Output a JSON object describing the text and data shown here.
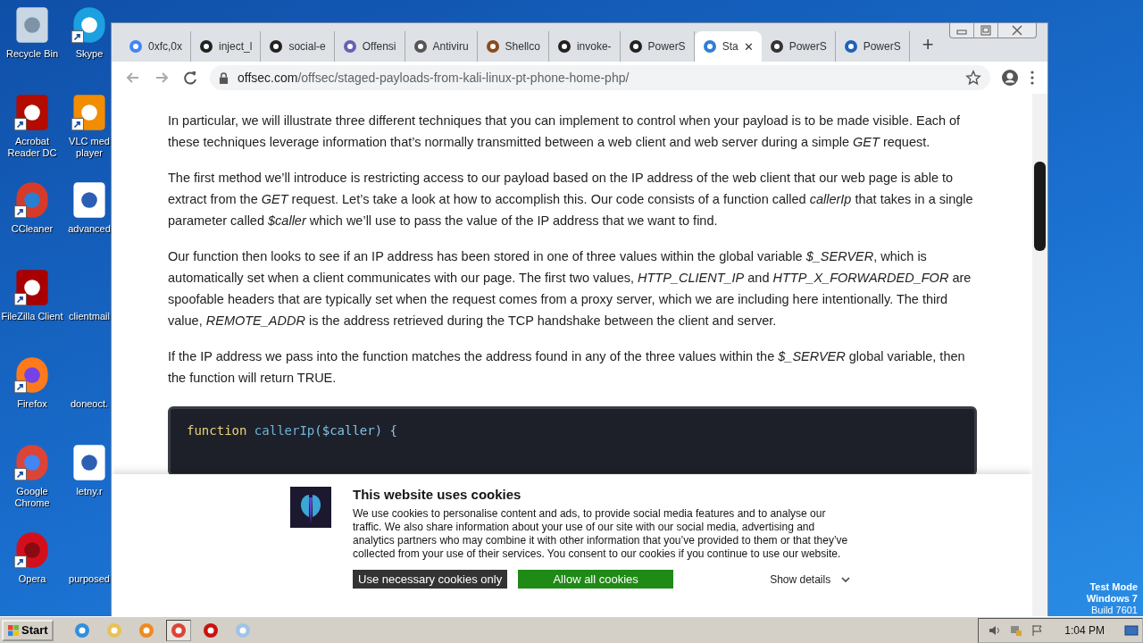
{
  "desktop": {
    "icons": [
      {
        "label": "Recycle Bin",
        "kind": "bin",
        "shortcut": false
      },
      {
        "label": "Skype",
        "kind": "skype",
        "shortcut": true
      },
      {
        "label": "Acrobat Reader DC",
        "kind": "pdf",
        "shortcut": true
      },
      {
        "label": "VLC med player",
        "kind": "cone",
        "shortcut": true
      },
      {
        "label": "CCleaner",
        "kind": "ccleaner",
        "shortcut": true
      },
      {
        "label": "advanced",
        "kind": "doc",
        "shortcut": false
      },
      {
        "label": "FileZilla Client",
        "kind": "filezilla",
        "shortcut": true
      },
      {
        "label": "clientmail",
        "kind": "blank"
      },
      {
        "label": "Firefox",
        "kind": "firefox",
        "shortcut": true
      },
      {
        "label": "doneoct.",
        "kind": "blank"
      },
      {
        "label": "Google Chrome",
        "kind": "chrome",
        "shortcut": true
      },
      {
        "label": "letny.r",
        "kind": "doc",
        "shortcut": false
      },
      {
        "label": "Opera",
        "kind": "opera",
        "shortcut": true
      },
      {
        "label": "purposed",
        "kind": "blank"
      }
    ]
  },
  "browser": {
    "tabs": [
      {
        "label": "0xfc,0x",
        "kind": "google",
        "selected": false
      },
      {
        "label": "inject_l",
        "kind": "github",
        "selected": false
      },
      {
        "label": "social-e",
        "kind": "github",
        "selected": false
      },
      {
        "label": "Offensi",
        "kind": "hex",
        "selected": false
      },
      {
        "label": "Antiviru",
        "kind": "globe",
        "selected": false
      },
      {
        "label": "Shellco",
        "kind": "bug",
        "selected": false
      },
      {
        "label": "invoke-",
        "kind": "github",
        "selected": false
      },
      {
        "label": "PowerS",
        "kind": "github",
        "selected": false
      },
      {
        "label": "Sta",
        "kind": "site",
        "selected": true
      },
      {
        "label": "PowerS",
        "kind": "pt",
        "selected": false
      },
      {
        "label": "PowerS",
        "kind": "ps",
        "selected": false
      }
    ],
    "tab_close": "✕",
    "new_tab": "+",
    "url_domain": "offsec.com",
    "url_path": "/offsec/staged-payloads-from-kali-linux-pt-phone-home-php/"
  },
  "article": {
    "paragraphs": [
      "In particular, we will illustrate three different techniques that you can implement to control when your payload is to be made visible. Each of these techniques leverage information that’s normally transmitted between a web client and web server during a simple *GET* request.",
      "The first method we’ll introduce is restricting access to our payload based on the IP address of the web client that our web page is able to extract from the *GET* request. Let’s take a look at how to accomplish this. Our code consists of a function called *callerIp* that takes in a single parameter called *$caller* which we’ll use to pass the value of the IP address that we want to find.",
      "Our function then looks to see if an IP address has been stored in one of three values within the global variable *$_SERVER*, which is automatically set when a client communicates with our page. The first two values, *HTTP_CLIENT_IP* and *HTTP_X_FORWARDED_FOR* are spoofable headers that are typically set when the request comes from a proxy server, which we are including here intentionally. The third value, *REMOTE_ADDR* is the address retrieved during the TCP handshake between the client and server.",
      "If the IP address we pass into the function matches the address found in any of the three values within the *$_SERVER* global variable, then the function will return TRUE."
    ],
    "code": [
      {
        "text": "function",
        "kind": "keyword"
      },
      {
        "text": " callerIp",
        "kind": "name"
      },
      {
        "text": "($caller)",
        "kind": "param"
      },
      {
        "text": " {",
        "kind": "plain"
      }
    ]
  },
  "cookie_banner": {
    "title": "This website uses cookies",
    "text": "We use cookies to personalise content and ads, to provide social media features and to analyse our traffic. We also share information about your use of our site with our social media, advertising and analytics partners who may combine it with other information that you’ve provided to them or that they’ve collected from your use of their services. You consent to our cookies if you continue to use our website.",
    "buttons": [
      {
        "label": "Use necessary cookies only",
        "kind": "dark"
      },
      {
        "label": "Allow all cookies",
        "kind": "green"
      }
    ],
    "details": "Show details"
  },
  "taskbar": {
    "start": "Start",
    "apps": [
      {
        "kind": "ie",
        "selected": false
      },
      {
        "kind": "folder",
        "selected": false
      },
      {
        "kind": "media",
        "selected": false
      },
      {
        "kind": "chrome",
        "selected": true
      },
      {
        "kind": "opera",
        "selected": false
      },
      {
        "kind": "notes",
        "selected": false
      }
    ],
    "time": "1:04 PM"
  },
  "watermark_os": [
    "Test Mode",
    "Windows 7",
    "Build 7601"
  ]
}
